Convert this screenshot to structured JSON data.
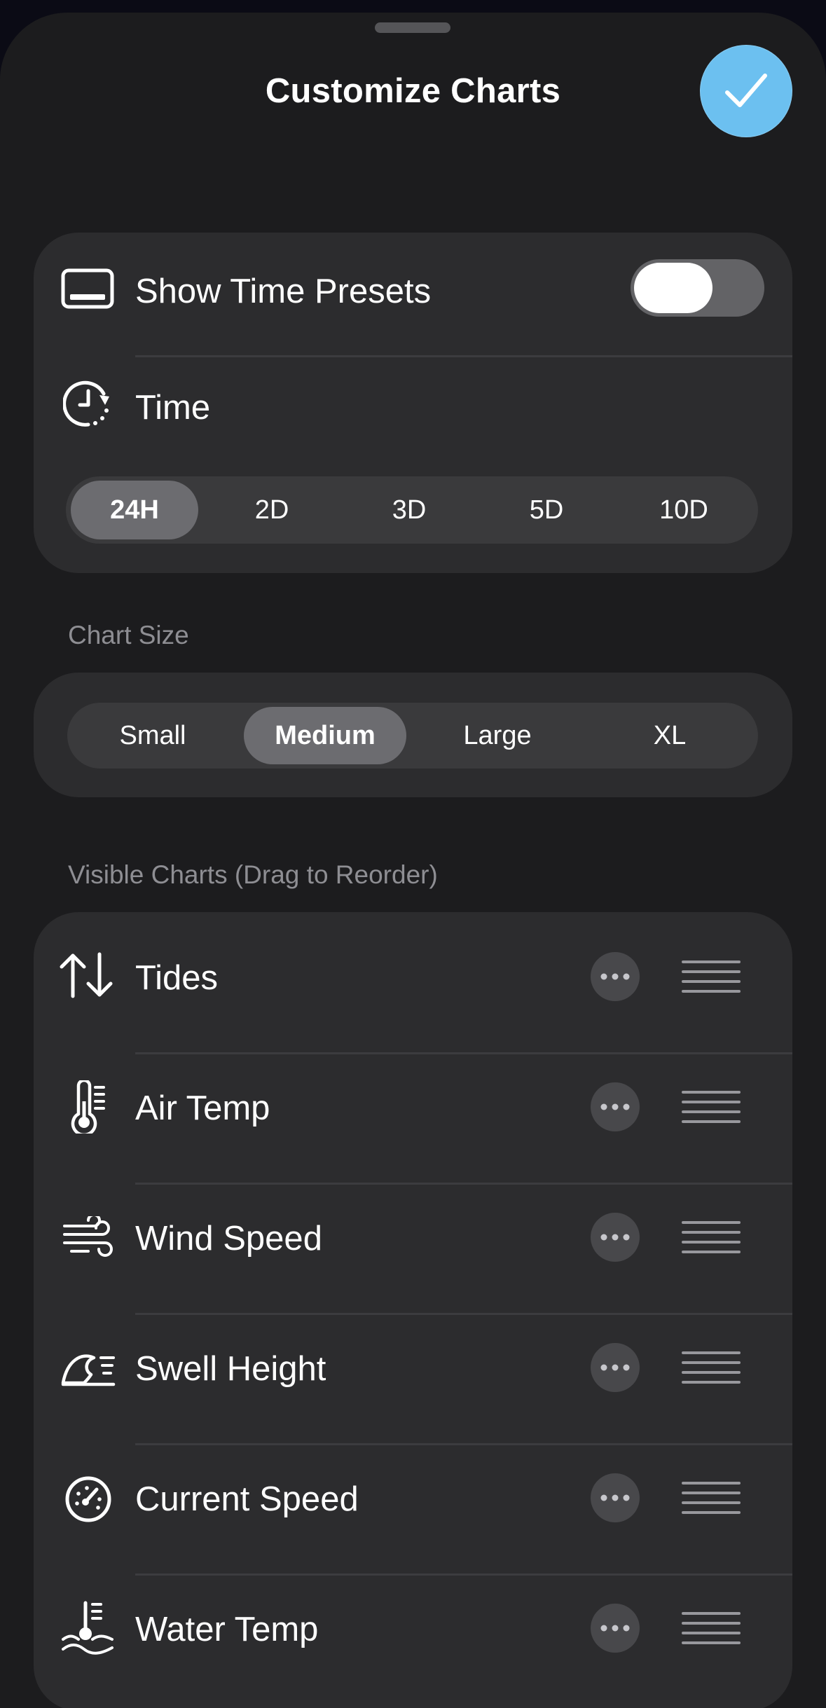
{
  "header": {
    "title": "Customize Charts",
    "done_icon": "checkmark-icon"
  },
  "time_card": {
    "show_presets": {
      "label": "Show Time Presets",
      "icon": "rectangle-bottom-icon",
      "toggle_on": false
    },
    "time": {
      "label": "Time",
      "icon": "clock-arrow-icon",
      "options": [
        "24H",
        "2D",
        "3D",
        "5D",
        "10D"
      ],
      "selected": "24H"
    }
  },
  "chart_size": {
    "section_title": "Chart Size",
    "options": [
      "Small",
      "Medium",
      "Large",
      "XL"
    ],
    "selected": "Medium"
  },
  "visible_charts": {
    "section_title": "Visible Charts (Drag to Reorder)",
    "items": [
      {
        "label": "Tides",
        "icon": "up-down-arrows-icon"
      },
      {
        "label": "Air Temp",
        "icon": "thermometer-icon"
      },
      {
        "label": "Wind Speed",
        "icon": "wind-icon"
      },
      {
        "label": "Swell Height",
        "icon": "wave-icon"
      },
      {
        "label": "Current Speed",
        "icon": "gauge-icon"
      },
      {
        "label": "Water Temp",
        "icon": "water-thermometer-icon"
      }
    ]
  },
  "colors": {
    "sheet_bg": "#1c1c1e",
    "card_bg": "#2c2c2e",
    "accent": "#6cc0f0",
    "secondary_text": "#8e8e93"
  }
}
